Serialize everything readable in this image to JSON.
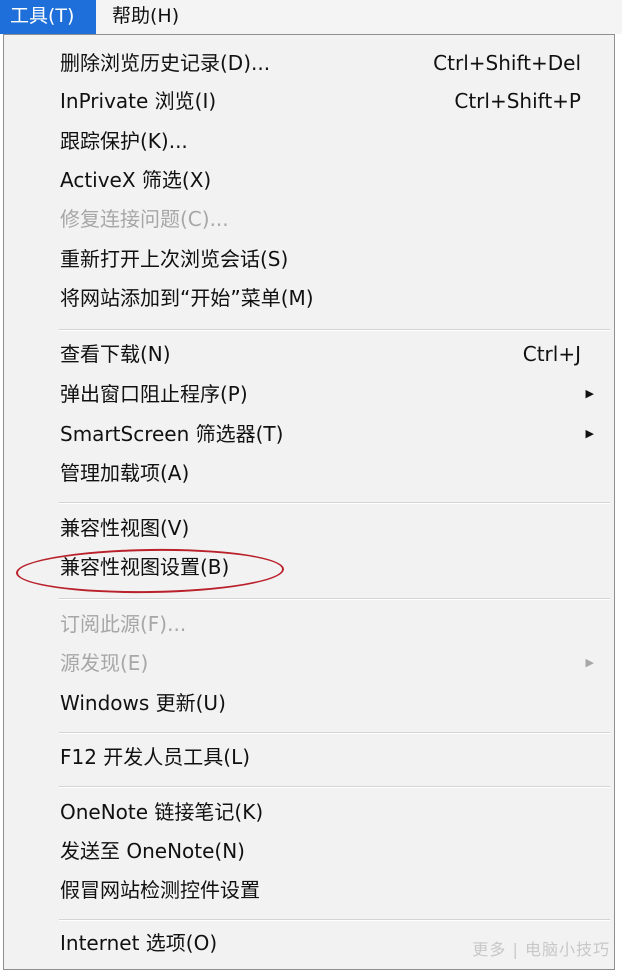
{
  "menubar": {
    "tools_label": "工具(T)",
    "help_label": "帮助(H)"
  },
  "menu": {
    "items": [
      {
        "label": "删除浏览历史记录(D)...",
        "shortcut": "Ctrl+Shift+Del"
      },
      {
        "label": "InPrivate 浏览(I)",
        "shortcut": "Ctrl+Shift+P"
      },
      {
        "label": "跟踪保护(K)..."
      },
      {
        "label": "ActiveX 筛选(X)"
      },
      {
        "label": "修复连接问题(C)..."
      },
      {
        "label": "重新打开上次浏览会话(S)"
      },
      {
        "label": "将网站添加到“开始”菜单(M)"
      },
      {
        "label": "查看下载(N)",
        "shortcut": "Ctrl+J"
      },
      {
        "label": "弹出窗口阻止程序(P)"
      },
      {
        "label": "SmartScreen 筛选器(T)"
      },
      {
        "label": "管理加载项(A)"
      },
      {
        "label": "兼容性视图(V)"
      },
      {
        "label": "兼容性视图设置(B)"
      },
      {
        "label": "订阅此源(F)..."
      },
      {
        "label": "源发现(E)"
      },
      {
        "label": "Windows 更新(U)"
      },
      {
        "label": "F12 开发人员工具(L)"
      },
      {
        "label": "OneNote 链接笔记(K)"
      },
      {
        "label": "发送至 OneNote(N)"
      },
      {
        "label": "假冒网站检测控件设置"
      },
      {
        "label": "Internet 选项(O)"
      }
    ]
  },
  "colors": {
    "menubar_active": "#1e6fd9",
    "disabled_text": "#a7a7a7",
    "annotation_ellipse": "#b9202a"
  },
  "icons": {
    "submenu_arrow": "▶"
  },
  "watermark": "更多 | 电脑小技巧"
}
